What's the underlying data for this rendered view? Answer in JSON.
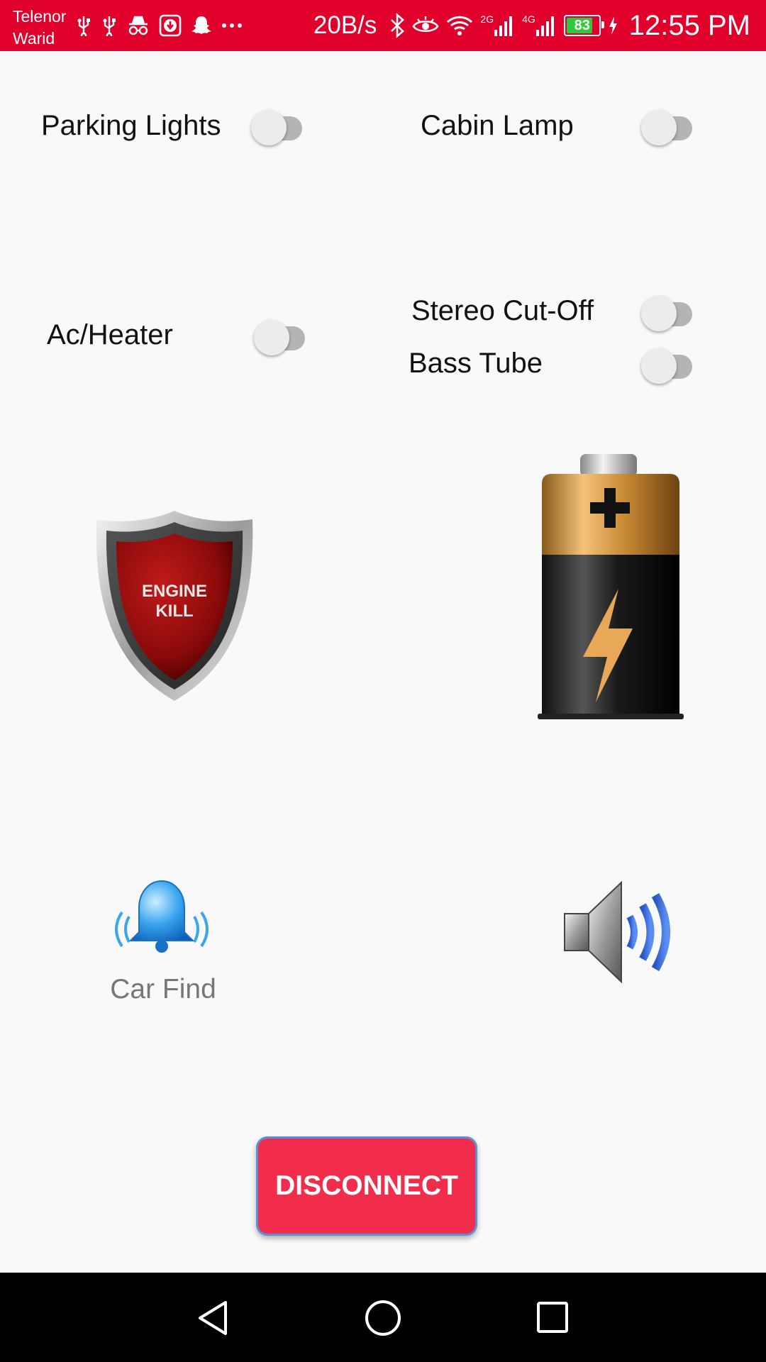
{
  "status_bar": {
    "carrier_line1": "Telenor",
    "carrier_line2": "Warid",
    "data_rate": "20B/s",
    "network_2g": "2G",
    "network_4g": "4G",
    "battery_level": "83",
    "time": "12:55 PM",
    "icons_left": [
      "usb-icon",
      "usb-icon",
      "incognito-icon",
      "download-icon",
      "snapchat-icon",
      "more-dots-icon"
    ],
    "icons_right": [
      "bluetooth-icon",
      "eye-icon",
      "wifi-icon",
      "signal-icon",
      "signal-icon",
      "battery-icon",
      "charging-icon"
    ]
  },
  "toggles": {
    "parking_lights": {
      "label": "Parking Lights",
      "on": false
    },
    "cabin_lamp": {
      "label": "Cabin Lamp",
      "on": false
    },
    "ac_heater": {
      "label": "Ac/Heater",
      "on": false
    },
    "stereo_cutoff": {
      "label": "Stereo Cut-Off",
      "on": false
    },
    "bass_tube": {
      "label": "Bass Tube",
      "on": false
    }
  },
  "engine_kill": {
    "line1": "ENGINE",
    "line2": "KILL",
    "icon": "shield-icon"
  },
  "battery_button": {
    "icon": "battery-icon"
  },
  "car_find": {
    "label": "Car Find",
    "icon": "bell-icon"
  },
  "speaker_button": {
    "icon": "speaker-icon"
  },
  "disconnect_label": "DISCONNECT",
  "nav": {
    "icons": [
      "back-icon",
      "home-icon",
      "recents-icon"
    ]
  },
  "colors": {
    "status_bar": "#e0002b",
    "disconnect_button": "#f22d4c",
    "background": "#f9f9fa",
    "switch_track_off": "#b4b4b4"
  }
}
